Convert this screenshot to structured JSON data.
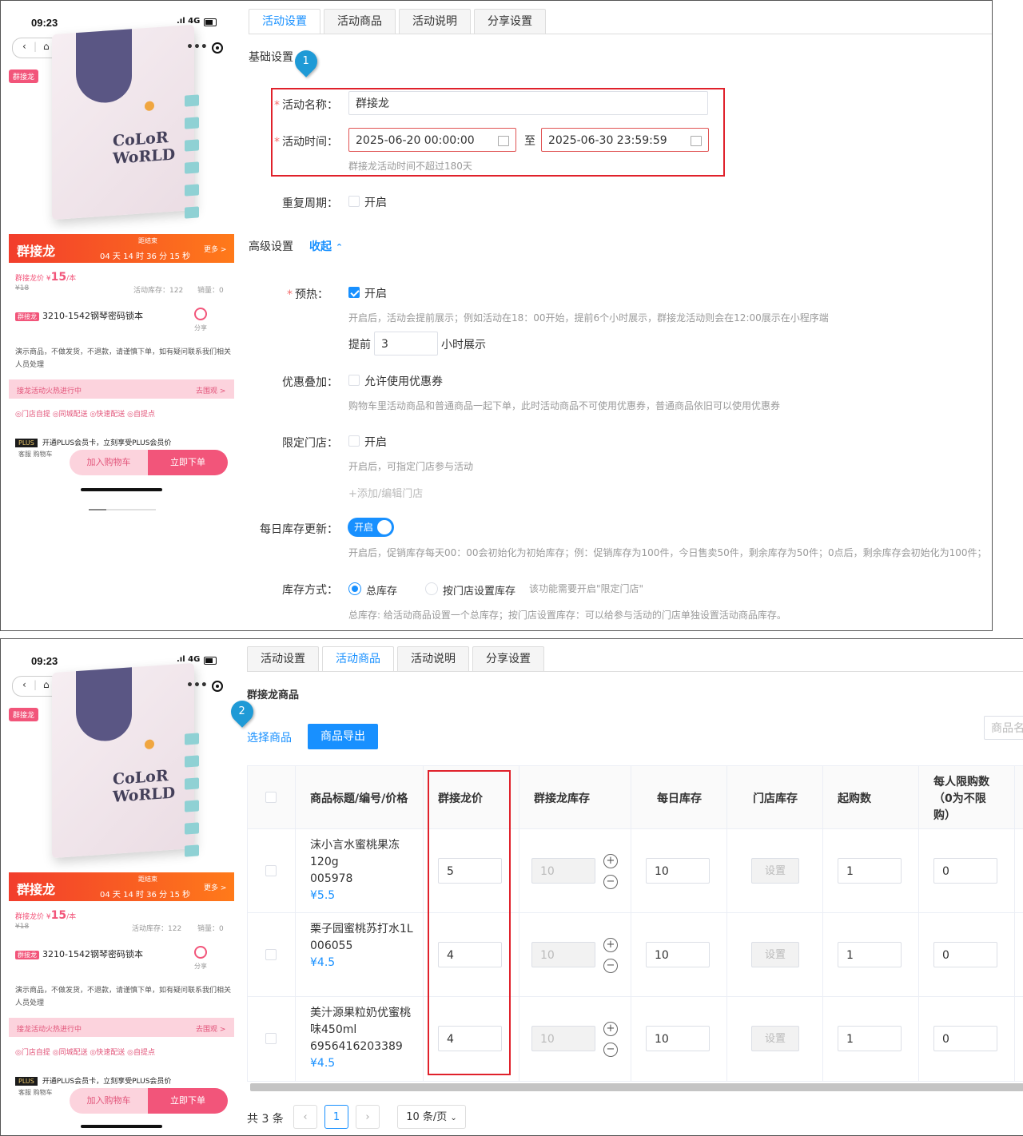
{
  "phone": {
    "time": "09:23",
    "signal": "4G",
    "tag": "群接龙",
    "book_title": "CoLoR WoRLD",
    "banner_title": "群接龙",
    "banner_end": "距结束",
    "countdown": "04 天 14 时 36 分 15 秒",
    "more": "更多 >",
    "price_label": "群接龙价 ¥",
    "price": "15",
    "unit": "/本",
    "orig_price": "¥18",
    "stock": "活动库存：122",
    "sales": "销量：0",
    "product_tag": "群接龙",
    "product_name": "3210-1542钢琴密码锁本",
    "share": "分享",
    "desc": "演示商品，不做发货，不退款，请谨慎下单，如有疑问联系我们相关人员处理",
    "hot": "接龙活动火热进行中",
    "go_watch": "去围观 >",
    "options": "◎门店自提  ◎同城配送  ◎快速配送  ◎自提点",
    "plus_badge": "PLUS",
    "plus_text": "开通PLUS会员卡，立刻享受PLUS会员价",
    "service": "客服",
    "cart": "购物车",
    "add_cart": "加入购物车",
    "buy_now": "立即下单"
  },
  "tabs": [
    "活动设置",
    "活动商品",
    "活动说明",
    "分享设置"
  ],
  "settings": {
    "basic_title": "基础设置",
    "marker1": "1",
    "name_label": "活动名称：",
    "name_value": "群接龙",
    "time_label": "活动时间：",
    "start": "2025-06-20 00:00:00",
    "to": "至",
    "end": "2025-06-30 23:59:59",
    "time_hint": "群接龙活动时间不超过180天",
    "repeat_label": "重复周期：",
    "enable": "开启",
    "advanced_title": "高级设置",
    "collapse": "收起",
    "preheat_label": "预热：",
    "preheat_hint": "开启后，活动会提前展示；例如活动在18：00开始，提前6个小时展示，群接龙活动则会在12:00展示在小程序端",
    "advance": "提前",
    "advance_value": "3",
    "hours_show": "小时展示",
    "coupon_label": "优惠叠加：",
    "coupon_text": "允许使用优惠券",
    "coupon_hint": "购物车里活动商品和普通商品一起下单，此时活动商品不可使用优惠券，普通商品依旧可以使用优惠券",
    "store_label": "限定门店：",
    "store_hint": "开启后，可指定门店参与活动",
    "add_store": "+添加/编辑门店",
    "daily_label": "每日库存更新：",
    "switch_on": "开启",
    "daily_hint": "开启后，促销库存每天00：00会初始化为初始库存；例：促销库存为100件，今日售卖50件，剩余库存为50件；0点后，剩余库存会初始化为100件；",
    "stock_label": "库存方式：",
    "total_stock": "总库存",
    "store_stock": "按门店设置库存",
    "store_stock_hint": "该功能需要开启\"限定门店\"",
    "stock_hint": "总库存: 给活动商品设置一个总库存；按门店设置库存：可以给参与活动的门店单独设置活动商品库存。"
  },
  "goods": {
    "title": "群接龙商品",
    "marker2": "2",
    "select": "选择商品",
    "export": "商品导出",
    "search_placeholder": "商品名",
    "headers": [
      "商品标题/编号/价格",
      "群接龙价",
      "群接龙库存",
      "每日库存",
      "门店库存",
      "起购数",
      "每人限购数（0为不限购）"
    ],
    "set_label": "设置",
    "rows": [
      {
        "name": "沫小言水蜜桃果冻120g",
        "code": "005978",
        "price": "¥5.5",
        "group_price": "5",
        "group_stock": "10",
        "daily": "10",
        "min": "1",
        "limit": "0"
      },
      {
        "name": "栗子园蜜桃苏打水1L",
        "code": "006055",
        "price": "¥4.5",
        "group_price": "4",
        "group_stock": "10",
        "daily": "10",
        "min": "1",
        "limit": "0"
      },
      {
        "name": "美汁源果粒奶优蜜桃味450ml",
        "code": "6956416203389",
        "price": "¥4.5",
        "group_price": "4",
        "group_stock": "10",
        "daily": "10",
        "min": "1",
        "limit": "0"
      }
    ],
    "total": "共 3 条",
    "page": "1",
    "page_size": "10 条/页"
  },
  "colors": {
    "primary": "#1890ff",
    "highlight": "#e0212b",
    "accent_pink": "#f2557a"
  }
}
